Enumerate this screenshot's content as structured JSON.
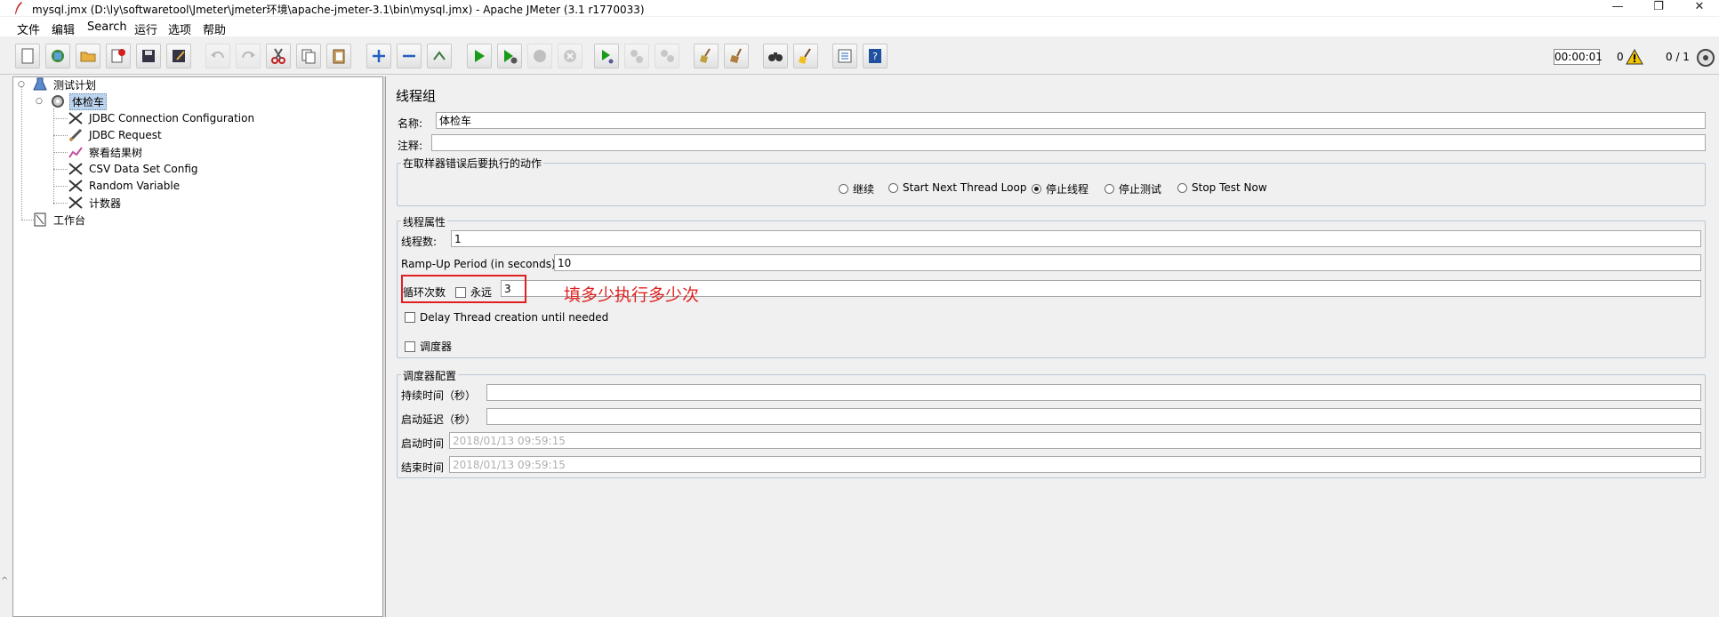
{
  "window": {
    "title": "mysql.jmx (D:\\ly\\softwaretool\\Jmeter\\jmeter环境\\apache-jmeter-3.1\\bin\\mysql.jmx) - Apache JMeter (3.1 r1770033)",
    "minimize": "—",
    "maximize": "❐",
    "close": "✕"
  },
  "menu": [
    "文件",
    "编辑",
    "Search",
    "运行",
    "选项",
    "帮助"
  ],
  "status": {
    "elapsed": "00:00:01",
    "errors": "0",
    "threads": "0 / 1"
  },
  "tree": {
    "root": "测试计划",
    "thread_group": "体检车",
    "children": [
      {
        "label": "JDBC Connection Configuration",
        "icon": "scissors-icon"
      },
      {
        "label": "JDBC Request",
        "icon": "pen-icon"
      },
      {
        "label": "察看结果树",
        "icon": "chart-icon"
      },
      {
        "label": "CSV Data Set Config",
        "icon": "scissors-icon"
      },
      {
        "label": "Random Variable",
        "icon": "scissors-icon"
      },
      {
        "label": "计数器",
        "icon": "scissors-icon"
      }
    ],
    "workbench": "工作台"
  },
  "panel": {
    "heading": "线程组",
    "name_label": "名称:",
    "name_value": "体检车",
    "comment_label": "注释:",
    "comment_value": "",
    "error_action": {
      "title": "在取样器错误后要执行的动作",
      "options": [
        "继续",
        "Start Next Thread Loop",
        "停止线程",
        "停止测试",
        "Stop Test Now"
      ],
      "selected": "停止线程"
    },
    "thread_props": {
      "title": "线程属性",
      "threads_label": "线程数:",
      "threads_value": "1",
      "rampup_label": "Ramp-Up Period (in seconds):",
      "rampup_value": "10",
      "loop_label": "循环次数",
      "forever_label": "永远",
      "loop_value": "3",
      "delay_label": "Delay Thread creation until needed",
      "scheduler_label": "调度器"
    },
    "scheduler": {
      "title": "调度器配置",
      "duration_label": "持续时间（秒）",
      "duration_value": "",
      "delay_label": "启动延迟（秒）",
      "delay_value": "",
      "start_label": "启动时间",
      "start_value": "2018/01/13 09:59:15",
      "end_label": "结束时间",
      "end_value": "2018/01/13 09:59:15"
    }
  },
  "annotation": "填多少执行多少次",
  "colors": {
    "annotation": "#e02020",
    "selection": "#bcd4ee"
  }
}
